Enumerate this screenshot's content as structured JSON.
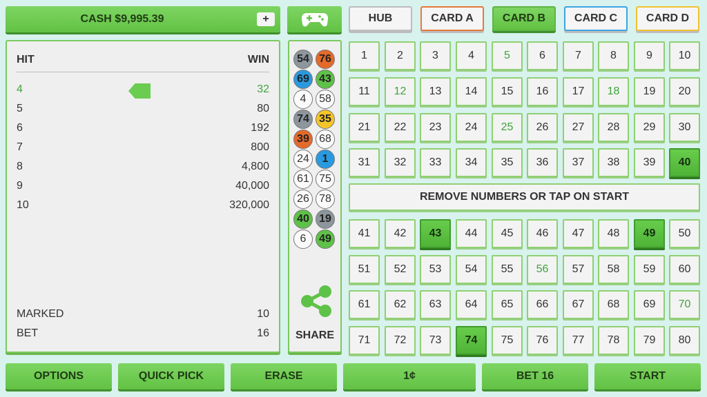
{
  "header": {
    "cash_label": "CASH $9,995.39",
    "add_cash": "+",
    "tabs": [
      "HUB",
      "CARD A",
      "CARD B",
      "CARD C",
      "CARD D"
    ],
    "active_tab": "CARD B"
  },
  "paytable": {
    "hit_header": "HIT",
    "win_header": "WIN",
    "rows": [
      {
        "hit": "4",
        "win": "32",
        "highlight": true
      },
      {
        "hit": "5",
        "win": "80",
        "highlight": false
      },
      {
        "hit": "6",
        "win": "192",
        "highlight": false
      },
      {
        "hit": "7",
        "win": "800",
        "highlight": false
      },
      {
        "hit": "8",
        "win": "4,800",
        "highlight": false
      },
      {
        "hit": "9",
        "win": "40,000",
        "highlight": false
      },
      {
        "hit": "10",
        "win": "320,000",
        "highlight": false
      }
    ],
    "marked_label": "MARKED",
    "marked_value": "10",
    "bet_label": "BET",
    "bet_value": "16"
  },
  "drawn": {
    "balls": [
      {
        "n": "54",
        "c": "gray"
      },
      {
        "n": "76",
        "c": "orange"
      },
      {
        "n": "69",
        "c": "blue"
      },
      {
        "n": "43",
        "c": "green"
      },
      {
        "n": "4",
        "c": "white"
      },
      {
        "n": "58",
        "c": "white"
      },
      {
        "n": "74",
        "c": "gray"
      },
      {
        "n": "35",
        "c": "yellow"
      },
      {
        "n": "39",
        "c": "orange"
      },
      {
        "n": "68",
        "c": "white"
      },
      {
        "n": "24",
        "c": "white"
      },
      {
        "n": "1",
        "c": "blue"
      },
      {
        "n": "61",
        "c": "white"
      },
      {
        "n": "75",
        "c": "white"
      },
      {
        "n": "26",
        "c": "white"
      },
      {
        "n": "78",
        "c": "white"
      },
      {
        "n": "40",
        "c": "green"
      },
      {
        "n": "19",
        "c": "gray"
      },
      {
        "n": "6",
        "c": "white"
      },
      {
        "n": "49",
        "c": "green"
      }
    ],
    "share_label": "SHARE"
  },
  "board": {
    "marked": [
      40,
      43,
      49,
      74
    ],
    "green_text": [
      5,
      12,
      18,
      25,
      56,
      70
    ],
    "message": "REMOVE NUMBERS OR TAP ON START"
  },
  "footer": {
    "options": "OPTIONS",
    "quick_pick": "QUICK PICK",
    "erase": "ERASE",
    "denomination": "1¢",
    "bet": "BET 16",
    "start": "START"
  },
  "colors": {
    "accent_green": "#62c244",
    "background": "#d8f2ee"
  }
}
